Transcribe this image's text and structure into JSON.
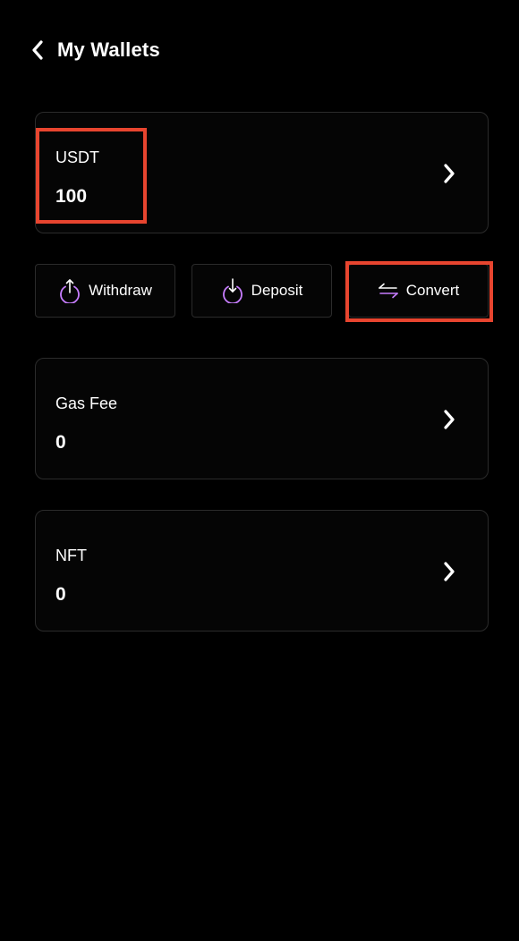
{
  "header": {
    "title": "My Wallets",
    "back_icon": "chevron-left-icon"
  },
  "wallets": [
    {
      "label": "USDT",
      "value": "100"
    },
    {
      "label": "Gas Fee",
      "value": "0"
    },
    {
      "label": "NFT",
      "value": "0"
    }
  ],
  "actions": [
    {
      "label": "Withdraw",
      "icon": "withdraw-icon"
    },
    {
      "label": "Deposit",
      "icon": "deposit-icon"
    },
    {
      "label": "Convert",
      "icon": "convert-icon"
    }
  ],
  "colors": {
    "background": "#000000",
    "accent_icon": "#c77dff",
    "highlight": "#e8452f",
    "card_border": "#2b2b2b"
  }
}
